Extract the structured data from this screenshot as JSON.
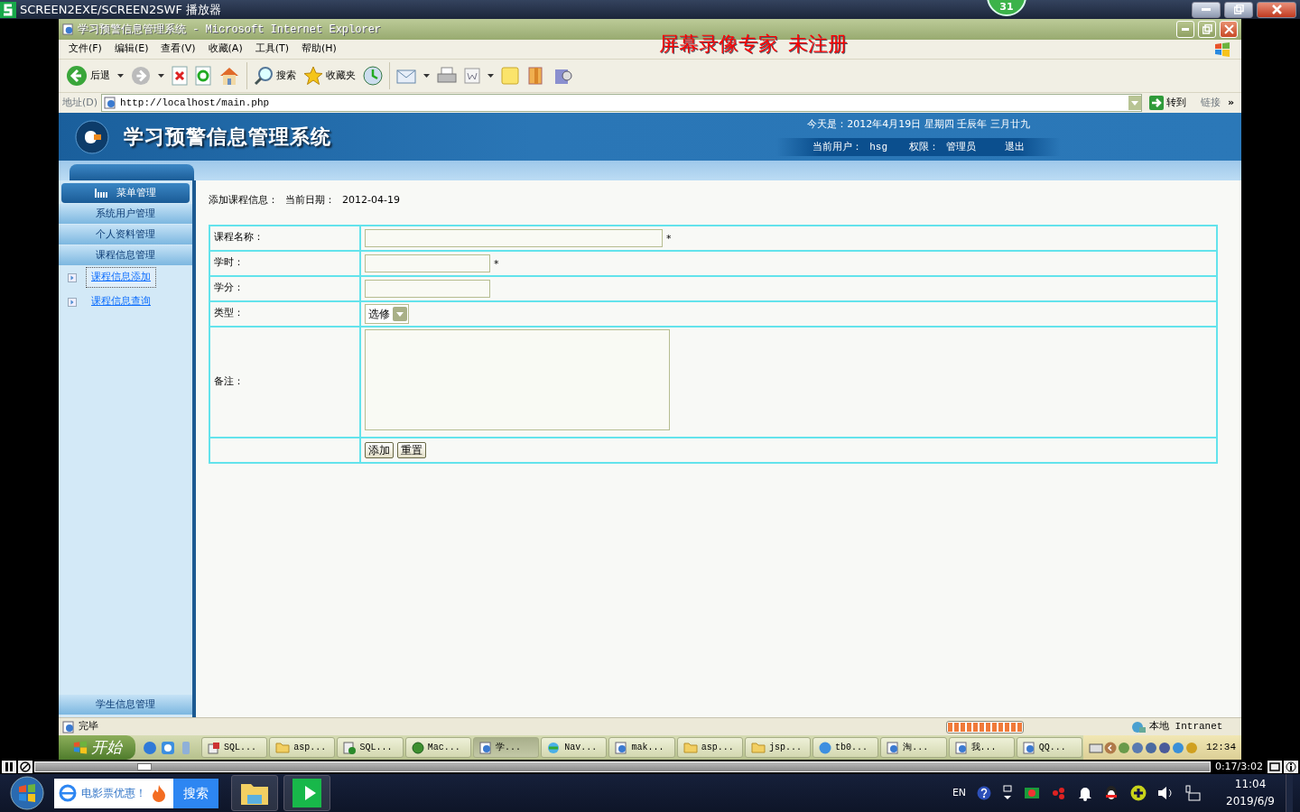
{
  "player": {
    "title": "SCREEN2EXE/SCREEN2SWF 播放器",
    "badge": "31",
    "seek": {
      "level": 0.093
    },
    "time": "0:17/3:02"
  },
  "browser": {
    "title": "学习预警信息管理系统 - Microsoft Internet Explorer",
    "watermark": "屏幕录像专家  未注册",
    "menu": [
      "文件(F)",
      "编辑(E)",
      "查看(V)",
      "收藏(A)",
      "工具(T)",
      "帮助(H)"
    ],
    "toolbar_groups": [
      {
        "items": [
          {
            "kind": "back",
            "label": "后退",
            "dropdown": true
          },
          {
            "kind": "forward",
            "dropdown": true
          },
          {
            "kind": "stop"
          },
          {
            "kind": "refresh"
          },
          {
            "kind": "home"
          }
        ]
      },
      {
        "items": [
          {
            "kind": "search",
            "label": "搜索"
          },
          {
            "kind": "favorites",
            "label": "收藏夹"
          },
          {
            "kind": "history"
          }
        ]
      },
      {
        "items": [
          {
            "kind": "mail",
            "dropdown": true
          },
          {
            "kind": "print"
          },
          {
            "kind": "edit",
            "dropdown": true
          },
          {
            "kind": "notes"
          },
          {
            "kind": "research"
          },
          {
            "kind": "messenger"
          }
        ]
      }
    ],
    "address": {
      "label": "地址(D)",
      "value": "http://localhost/main.php",
      "go": "转到",
      "links": "链接",
      "more": "»"
    },
    "status": {
      "text": "完毕",
      "progress": {
        "level": 1
      },
      "zone": "本地 Intranet"
    }
  },
  "app": {
    "header": {
      "title": "学习预警信息管理系统",
      "date": "今天是：2012年4月19日  星期四  壬辰年  三月廿九",
      "user_label": "当前用户：",
      "user": "hsg",
      "role_label": "权限：",
      "role": "管理员",
      "logout": "退出"
    },
    "sidebar": {
      "heading": "菜单管理",
      "items": [
        {
          "kind": "group",
          "label": "系统用户管理",
          "selected": false
        },
        {
          "kind": "group",
          "label": "个人资料管理",
          "selected": false
        },
        {
          "kind": "group",
          "label": "课程信息管理",
          "selected": false
        },
        {
          "kind": "link",
          "label": "课程信息添加",
          "selected": true
        },
        {
          "kind": "link",
          "label": "课程信息查询",
          "selected": false
        }
      ],
      "footer_item": "学生信息管理"
    },
    "form": {
      "heading": "添加课程信息：",
      "date_label": "当前日期：",
      "date": "2012-04-19",
      "fields": [
        {
          "label": "课程名称：",
          "kind": "wide_text",
          "required": true,
          "required_mark": "*"
        },
        {
          "label": "学时：",
          "kind": "text",
          "required": true,
          "required_mark": "*"
        },
        {
          "label": "学分：",
          "kind": "text",
          "required": false
        },
        {
          "label": "类型：",
          "kind": "select",
          "value": "选修"
        },
        {
          "label": "备注：",
          "kind": "textarea"
        }
      ],
      "buttons": [
        "添加",
        "重置"
      ]
    }
  },
  "xp_taskbar": {
    "start": "开始",
    "tasks": [
      {
        "label": "SQL...",
        "kind": "tool",
        "selected": false
      },
      {
        "label": "asp...",
        "kind": "folder",
        "selected": false
      },
      {
        "label": "SQL...",
        "kind": "media",
        "selected": false
      },
      {
        "label": "Mac...",
        "kind": "green",
        "selected": false
      },
      {
        "label": "学...",
        "kind": "ie",
        "selected": true
      },
      {
        "label": "Nav...",
        "kind": "globe",
        "selected": false
      },
      {
        "label": "mak...",
        "kind": "ie",
        "selected": false
      },
      {
        "label": "asp...",
        "kind": "folder",
        "selected": false
      },
      {
        "label": "jsp...",
        "kind": "folder",
        "selected": false
      },
      {
        "label": "tb0...",
        "kind": "blue",
        "selected": false
      },
      {
        "label": "淘...",
        "kind": "ie",
        "selected": false
      },
      {
        "label": "我...",
        "kind": "ie",
        "selected": false
      },
      {
        "label": "QQ...",
        "kind": "ie",
        "selected": false
      }
    ],
    "clock": "12:34"
  },
  "win_taskbar": {
    "search_text": "电影票优惠！",
    "search_button": "搜索",
    "language": "EN",
    "time": "11:04",
    "date": "2019/6/9"
  }
}
